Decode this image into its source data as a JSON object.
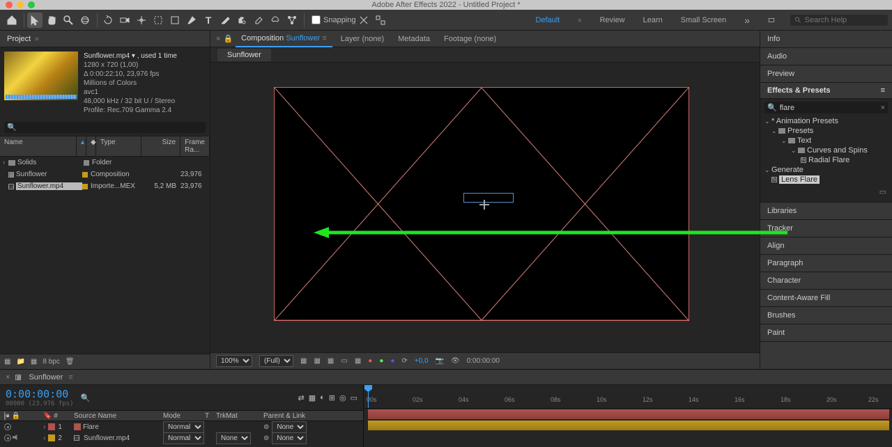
{
  "app": {
    "title": "Adobe After Effects 2022 - Untitled Project *"
  },
  "toolbar": {
    "snapping_label": "Snapping",
    "workspaces": {
      "default": "Default",
      "review": "Review",
      "learn": "Learn",
      "small": "Small Screen"
    },
    "search_placeholder": "Search Help"
  },
  "project": {
    "panel_title": "Project",
    "meta": {
      "title": "Sunflower.mp4 ▾ , used 1 time",
      "dims": "1280 x 720 (1,00)",
      "duration": "Δ 0:00:22:10, 23,976 fps",
      "colors": "Millions of Colors",
      "codec": "avc1",
      "audio": "48,000 kHz / 32 bit U / Stereo",
      "profile": "Profile: Rec.709 Gamma 2.4"
    },
    "columns": {
      "name": "Name",
      "type": "Type",
      "size": "Size",
      "rate": "Frame Ra..."
    },
    "rows": [
      {
        "name": "Solids",
        "type": "Folder",
        "size": "",
        "rate": ""
      },
      {
        "name": "Sunflower",
        "type": "Composition",
        "size": "",
        "rate": "23,976"
      },
      {
        "name": "Sunflower.mp4",
        "type": "Importe...MEX",
        "size": "5,2 MB",
        "rate": "23,976"
      }
    ],
    "footer_bpc": "8 bpc"
  },
  "composition": {
    "tabs": {
      "comp_prefix": "Composition",
      "comp_name": "Sunflower",
      "layer": "Layer (none)",
      "metadata": "Metadata",
      "footage": "Footage (none)"
    },
    "active_tab": "Sunflower",
    "footer": {
      "zoom": "100%",
      "res": "(Full)",
      "exposure": "+0,0",
      "time": "0:00:00:00"
    }
  },
  "right_panels": {
    "items_top": [
      "Info",
      "Audio",
      "Preview"
    ],
    "effects_presets": {
      "title": "Effects & Presets",
      "search_value": "flare",
      "tree": {
        "root": "* Animation Presets",
        "presets": "Presets",
        "text": "Text",
        "curves": "Curves and Spins",
        "radial": "Radial Flare",
        "generate": "Generate",
        "lens": "Lens Flare"
      }
    },
    "items_bottom": [
      "Libraries",
      "Tracker",
      "Align",
      "Paragraph",
      "Character",
      "Content-Aware Fill",
      "Brushes",
      "Paint"
    ]
  },
  "timeline": {
    "comp_tab": "Sunflower",
    "timecode": "0:00:00:00",
    "timecode_sub": "00000 (23.976 fps)",
    "columns": {
      "source": "Source Name",
      "mode": "Mode",
      "t": "T",
      "trk": "TrkMat",
      "parent": "Parent & Link",
      "num": "#"
    },
    "layers": [
      {
        "num": "1",
        "name": "Flare",
        "mode": "Normal",
        "trk": "",
        "parent": "None",
        "color": "#b0524e"
      },
      {
        "num": "2",
        "name": "Sunflower.mp4",
        "mode": "Normal",
        "trk": "None",
        "parent": "None",
        "color": "#c49b20"
      }
    ],
    "ruler_ticks": [
      "00s",
      "02s",
      "04s",
      "06s",
      "08s",
      "10s",
      "12s",
      "14s",
      "16s",
      "18s",
      "20s",
      "22s"
    ]
  }
}
